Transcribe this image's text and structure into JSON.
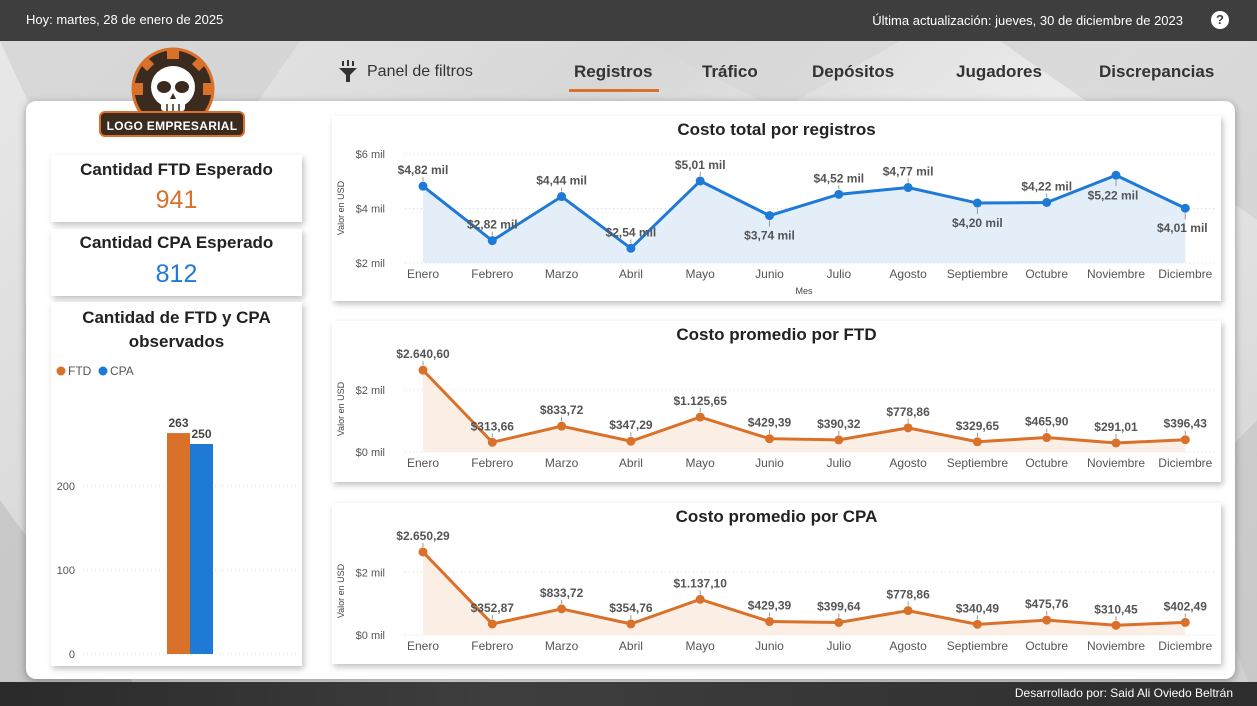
{
  "topbar": {
    "today": "Hoy: martes, 28 de enero de 2025",
    "updated": "Última actualización: jueves, 30 de diciembre de 2023",
    "help_symbol": "?"
  },
  "logo": {
    "text": "LOGO EMPRESARIAL",
    "icon": "skull-logo-icon"
  },
  "nav": {
    "filter_label": "Panel de filtros",
    "filter_icon": "funnel-icon",
    "tabs": [
      {
        "label": "Registros",
        "active": true
      },
      {
        "label": "Tráfico",
        "active": false
      },
      {
        "label": "Depósitos",
        "active": false
      },
      {
        "label": "Jugadores",
        "active": false
      },
      {
        "label": "Discrepancias",
        "active": false
      }
    ]
  },
  "kpis": {
    "ftd": {
      "title": "Cantidad FTD Esperado",
      "value": "941",
      "color": "#d9712b"
    },
    "cpa": {
      "title": "Cantidad CPA Esperado",
      "value": "812",
      "color": "#1f7ad6"
    }
  },
  "colors": {
    "orange": "#d9712b",
    "blue": "#1f7ad6",
    "accent": "#d9712b"
  },
  "footer": {
    "credit": "Desarrollado por: Said Ali Oviedo Beltrán"
  },
  "chart_data": [
    {
      "id": "observados",
      "type": "bar",
      "title": "Cantidad de FTD y CPA observados",
      "legend": [
        "FTD",
        "CPA"
      ],
      "legend_position": "top-left",
      "series": [
        {
          "name": "FTD",
          "values": [
            263
          ],
          "color": "#d9712b"
        },
        {
          "name": "CPA",
          "values": [
            250
          ],
          "color": "#1f7ad6"
        }
      ],
      "value_labels": [
        "263",
        "250"
      ],
      "ylim": [
        0,
        300
      ],
      "yticks": [
        0,
        100,
        200
      ],
      "ytick_labels": [
        "0",
        "100",
        "200"
      ],
      "grid": true
    },
    {
      "id": "costo_total",
      "type": "area",
      "title": "Costo total por registros",
      "xlabel": "Mes",
      "ylabel": "Valor en USD",
      "categories": [
        "Enero",
        "Febrero",
        "Marzo",
        "Abril",
        "Mayo",
        "Junio",
        "Julio",
        "Agosto",
        "Septiembre",
        "Octubre",
        "Noviembre",
        "Diciembre"
      ],
      "values": [
        4820,
        2820,
        4440,
        2540,
        5010,
        3740,
        4520,
        4770,
        4200,
        4220,
        5220,
        4010
      ],
      "labels": [
        "$4,82 mil",
        "$2,82 mil",
        "$4,44 mil",
        "$2,54 mil",
        "$5,01 mil",
        "$3,74 mil",
        "$4,52 mil",
        "$4,77 mil",
        "$4,20 mil",
        "$4,22 mil",
        "$5,22 mil",
        "$4,01 mil"
      ],
      "ylim": [
        2000,
        6000
      ],
      "yticks": [
        2000,
        4000,
        6000
      ],
      "ytick_labels": [
        "$2 mil",
        "$4 mil",
        "$6 mil"
      ],
      "color": "#1f7ad6",
      "fill": "#e3eef9",
      "grid": true
    },
    {
      "id": "costo_ftd",
      "type": "area",
      "title": "Costo promedio por FTD",
      "xlabel": "",
      "ylabel": "Valor en USD",
      "categories": [
        "Enero",
        "Febrero",
        "Marzo",
        "Abril",
        "Mayo",
        "Junio",
        "Julio",
        "Agosto",
        "Septiembre",
        "Octubre",
        "Noviembre",
        "Diciembre"
      ],
      "values": [
        2640.6,
        313.66,
        833.72,
        347.29,
        1125.65,
        429.39,
        390.32,
        778.86,
        329.65,
        465.9,
        291.01,
        396.43
      ],
      "labels": [
        "$2.640,60",
        "$313,66",
        "$833,72",
        "$347,29",
        "$1.125,65",
        "$429,39",
        "$390,32",
        "$778,86",
        "$329,65",
        "$465,90",
        "$291,01",
        "$396,43"
      ],
      "ylim": [
        0,
        3000
      ],
      "yticks": [
        0,
        2000
      ],
      "ytick_labels": [
        "$0 mil",
        "$2 mil"
      ],
      "color": "#d9712b",
      "fill": "#fbeee4",
      "grid": true
    },
    {
      "id": "costo_cpa",
      "type": "area",
      "title": "Costo promedio por CPA",
      "xlabel": "",
      "ylabel": "Valor en USD",
      "categories": [
        "Enero",
        "Febrero",
        "Marzo",
        "Abril",
        "Mayo",
        "Junio",
        "Julio",
        "Agosto",
        "Septiembre",
        "Octubre",
        "Noviembre",
        "Diciembre"
      ],
      "values": [
        2650.29,
        352.87,
        833.72,
        354.76,
        1137.1,
        429.39,
        399.64,
        778.86,
        340.49,
        475.76,
        310.45,
        402.49
      ],
      "labels": [
        "$2.650,29",
        "$352,87",
        "$833,72",
        "$354,76",
        "$1.137,10",
        "$429,39",
        "$399,64",
        "$778,86",
        "$340,49",
        "$475,76",
        "$310,45",
        "$402,49"
      ],
      "ylim": [
        0,
        3000
      ],
      "yticks": [
        0,
        2000
      ],
      "ytick_labels": [
        "$0 mil",
        "$2 mil"
      ],
      "color": "#d9712b",
      "fill": "#fbeee4",
      "grid": true
    }
  ]
}
